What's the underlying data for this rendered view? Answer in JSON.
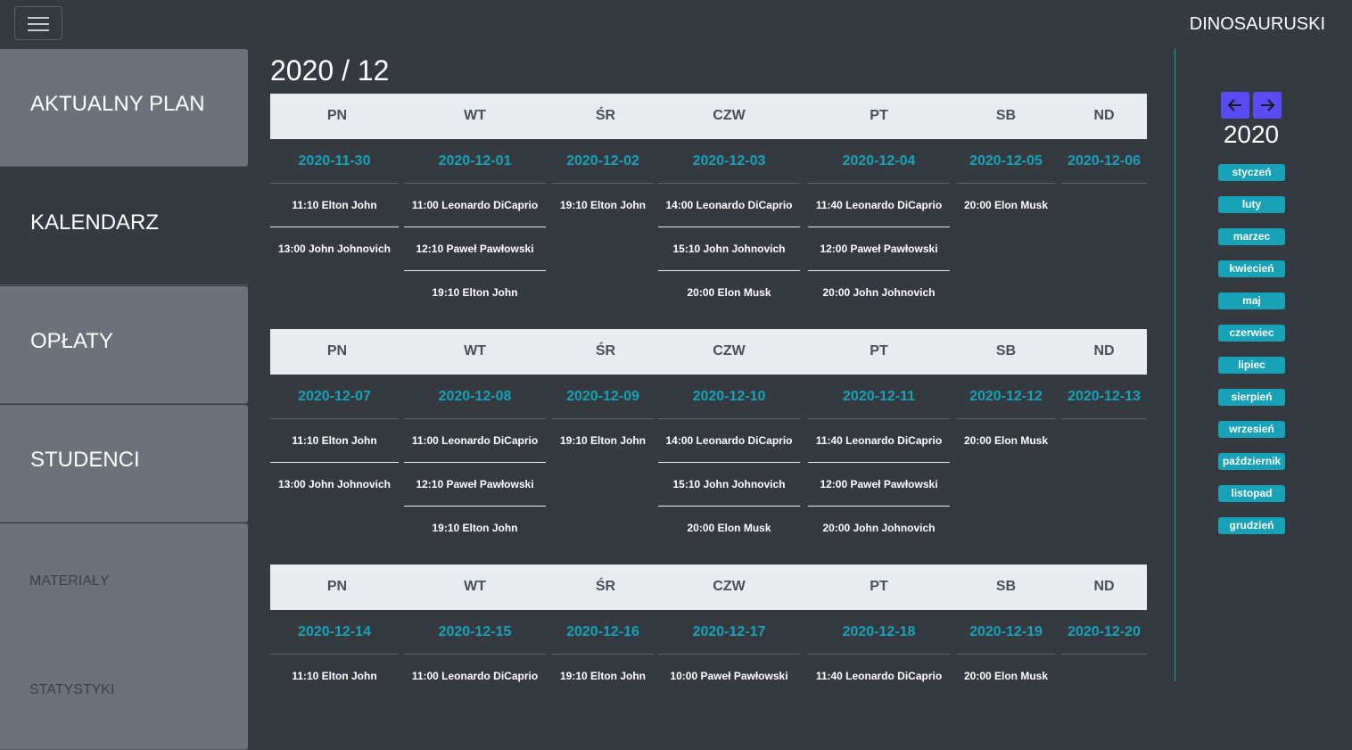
{
  "app": {
    "brand": "DINOSAURUSKI"
  },
  "sidebar": {
    "items": [
      {
        "label": "AKTUALNY PLAN"
      },
      {
        "label": "KALENDARZ"
      },
      {
        "label": "OPŁATY"
      },
      {
        "label": "STUDENCI"
      },
      {
        "label": "MATERIAŁY"
      },
      {
        "label": "STATYSTYKI"
      }
    ]
  },
  "calendar": {
    "title": "2020 / 12",
    "day_names": [
      "PN",
      "WT",
      "ŚR",
      "CZW",
      "PT",
      "SB",
      "ND"
    ],
    "weeks": [
      {
        "days": [
          {
            "date": "2020-11-30",
            "entries": [
              "11:10 Elton John",
              "13:00 John Johnovich"
            ]
          },
          {
            "date": "2020-12-01",
            "entries": [
              "11:00 Leonardo DiCaprio",
              "12:10 Paweł Pawłowski",
              "19:10 Elton John"
            ]
          },
          {
            "date": "2020-12-02",
            "entries": [
              "19:10 Elton John"
            ]
          },
          {
            "date": "2020-12-03",
            "entries": [
              "14:00 Leonardo DiCaprio",
              "15:10 John Johnovich",
              "20:00 Elon Musk"
            ]
          },
          {
            "date": "2020-12-04",
            "entries": [
              "11:40 Leonardo DiCaprio",
              "12:00 Paweł Pawłowski",
              "20:00 John Johnovich"
            ]
          },
          {
            "date": "2020-12-05",
            "entries": [
              "20:00 Elon Musk"
            ]
          },
          {
            "date": "2020-12-06",
            "entries": []
          }
        ]
      },
      {
        "days": [
          {
            "date": "2020-12-07",
            "entries": [
              "11:10 Elton John",
              "13:00 John Johnovich"
            ]
          },
          {
            "date": "2020-12-08",
            "entries": [
              "11:00 Leonardo DiCaprio",
              "12:10 Paweł Pawłowski",
              "19:10 Elton John"
            ]
          },
          {
            "date": "2020-12-09",
            "entries": [
              "19:10 Elton John"
            ]
          },
          {
            "date": "2020-12-10",
            "entries": [
              "14:00 Leonardo DiCaprio",
              "15:10 John Johnovich",
              "20:00 Elon Musk"
            ]
          },
          {
            "date": "2020-12-11",
            "entries": [
              "11:40 Leonardo DiCaprio",
              "12:00 Paweł Pawłowski",
              "20:00 John Johnovich"
            ]
          },
          {
            "date": "2020-12-12",
            "entries": [
              "20:00 Elon Musk"
            ]
          },
          {
            "date": "2020-12-13",
            "entries": []
          }
        ]
      },
      {
        "days": [
          {
            "date": "2020-12-14",
            "entries": [
              "11:10 Elton John"
            ]
          },
          {
            "date": "2020-12-15",
            "entries": [
              "11:00 Leonardo DiCaprio"
            ]
          },
          {
            "date": "2020-12-16",
            "entries": [
              "19:10 Elton John"
            ]
          },
          {
            "date": "2020-12-17",
            "entries": [
              "10:00 Paweł Pawłowski"
            ]
          },
          {
            "date": "2020-12-18",
            "entries": [
              "11:40 Leonardo DiCaprio"
            ]
          },
          {
            "date": "2020-12-19",
            "entries": [
              "20:00 Elon Musk"
            ]
          },
          {
            "date": "2020-12-20",
            "entries": []
          }
        ]
      }
    ]
  },
  "year_panel": {
    "year": "2020",
    "prev_icon": "arrow-left-icon",
    "next_icon": "arrow-right-icon",
    "months": [
      "styczeń",
      "luty",
      "marzec",
      "kwiecień",
      "maj",
      "czerwiec",
      "lipiec",
      "sierpień",
      "wrzesień",
      "październik",
      "listopad",
      "grudzień"
    ]
  },
  "colors": {
    "background": "#343a40",
    "sidebar_item": "#6c727a",
    "accent": "#17a2b8",
    "header_bg": "#e9ecef",
    "arrow_button": "#5a4cf5"
  }
}
